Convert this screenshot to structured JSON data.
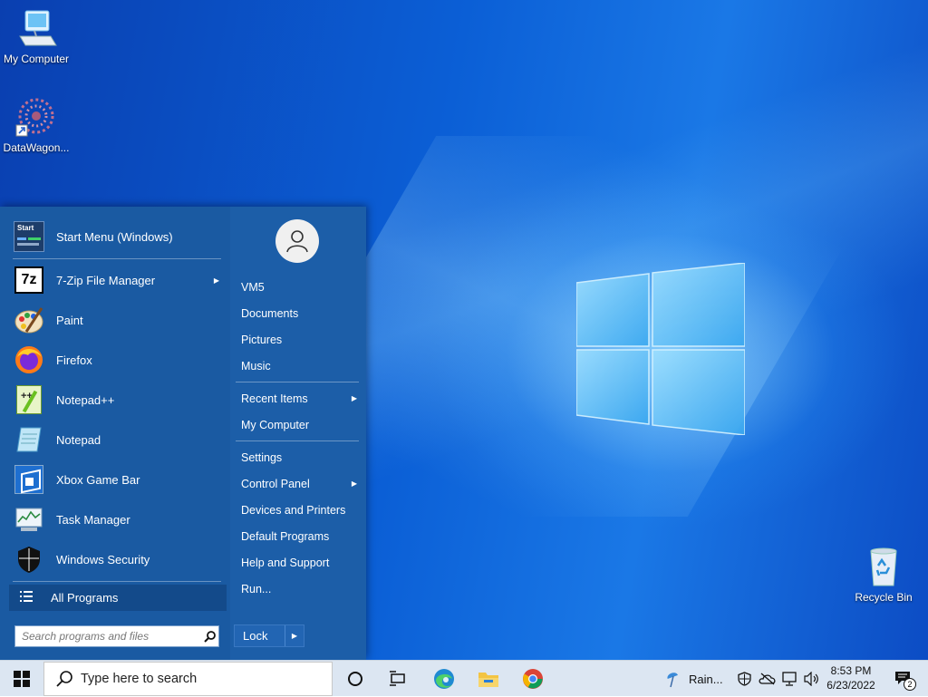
{
  "desktop": {
    "icons": [
      {
        "label": "My Computer"
      },
      {
        "label": "DataWagon..."
      },
      {
        "label": "Recycle Bin"
      }
    ]
  },
  "start_menu": {
    "pinned": [
      {
        "label": "Start Menu (Windows)",
        "icon": "start-menu-settings-icon"
      },
      {
        "label": "7-Zip File Manager",
        "icon": "7zip-icon",
        "has_submenu": true
      },
      {
        "label": "Paint",
        "icon": "paint-icon"
      },
      {
        "label": "Firefox",
        "icon": "firefox-icon"
      },
      {
        "label": "Notepad++",
        "icon": "notepadpp-icon"
      },
      {
        "label": "Notepad",
        "icon": "notepad-icon"
      },
      {
        "label": "Xbox Game Bar",
        "icon": "xbox-game-bar-icon"
      },
      {
        "label": "Task Manager",
        "icon": "task-manager-icon"
      },
      {
        "label": "Windows Security",
        "icon": "shield-icon"
      }
    ],
    "start_icon_text": "Start",
    "all_programs": "All Programs",
    "search_placeholder": "Search programs and files",
    "right_items": [
      {
        "label": "VM5"
      },
      {
        "label": "Documents"
      },
      {
        "label": "Pictures"
      },
      {
        "label": "Music"
      },
      {
        "label": "Recent Items",
        "has_submenu": true
      },
      {
        "label": "My Computer"
      },
      {
        "label": "Settings"
      },
      {
        "label": "Control Panel",
        "has_submenu": true
      },
      {
        "label": "Devices and Printers"
      },
      {
        "label": "Default Programs"
      },
      {
        "label": "Help and Support"
      },
      {
        "label": "Run..."
      }
    ],
    "lock_label": "Lock",
    "seven_zip_text": "7z",
    "notepadpp_text": "++"
  },
  "taskbar": {
    "search_text": "Type here to search",
    "weather_text": "Rain...",
    "time": "8:53 PM",
    "date": "6/23/2022",
    "notification_count": "2"
  }
}
